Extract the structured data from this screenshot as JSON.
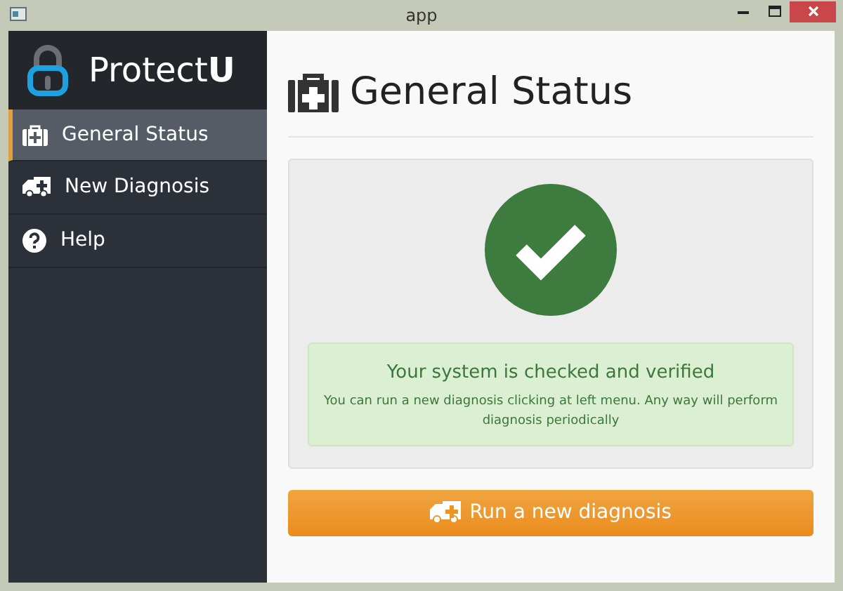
{
  "window": {
    "title": "app"
  },
  "sidebar": {
    "brand": {
      "name": "Protect",
      "suffix": "U"
    },
    "items": [
      {
        "label": "General Status",
        "kind": "medkit",
        "selected": true
      },
      {
        "label": "New Diagnosis",
        "kind": "ambulance",
        "selected": false
      },
      {
        "label": "Help",
        "kind": "help",
        "selected": false
      }
    ]
  },
  "main": {
    "title": "General Status",
    "status": {
      "ok": true,
      "heading": "Your system is checked and verified",
      "message": "You can run a new diagnosis clicking at left menu. Any way will perform diagnosis periodically"
    },
    "button": "Run a new diagnosis"
  }
}
